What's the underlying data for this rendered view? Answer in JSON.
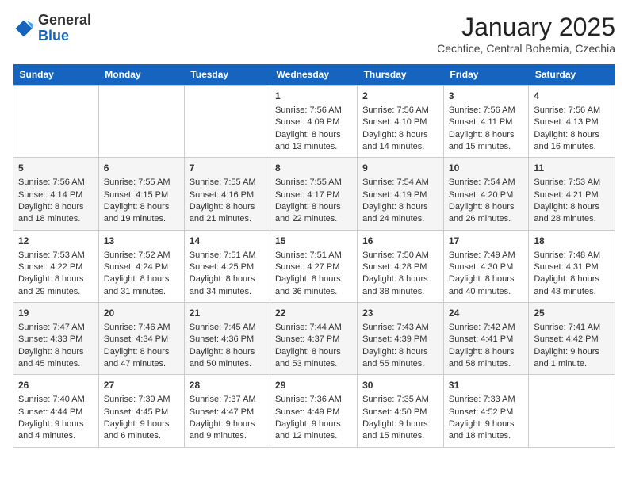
{
  "header": {
    "logo_line1": "General",
    "logo_line2": "Blue",
    "title": "January 2025",
    "location": "Cechtice, Central Bohemia, Czechia"
  },
  "days_of_week": [
    "Sunday",
    "Monday",
    "Tuesday",
    "Wednesday",
    "Thursday",
    "Friday",
    "Saturday"
  ],
  "weeks": [
    [
      {
        "day": "",
        "info": ""
      },
      {
        "day": "",
        "info": ""
      },
      {
        "day": "",
        "info": ""
      },
      {
        "day": "1",
        "info": "Sunrise: 7:56 AM\nSunset: 4:09 PM\nDaylight: 8 hours\nand 13 minutes."
      },
      {
        "day": "2",
        "info": "Sunrise: 7:56 AM\nSunset: 4:10 PM\nDaylight: 8 hours\nand 14 minutes."
      },
      {
        "day": "3",
        "info": "Sunrise: 7:56 AM\nSunset: 4:11 PM\nDaylight: 8 hours\nand 15 minutes."
      },
      {
        "day": "4",
        "info": "Sunrise: 7:56 AM\nSunset: 4:13 PM\nDaylight: 8 hours\nand 16 minutes."
      }
    ],
    [
      {
        "day": "5",
        "info": "Sunrise: 7:56 AM\nSunset: 4:14 PM\nDaylight: 8 hours\nand 18 minutes."
      },
      {
        "day": "6",
        "info": "Sunrise: 7:55 AM\nSunset: 4:15 PM\nDaylight: 8 hours\nand 19 minutes."
      },
      {
        "day": "7",
        "info": "Sunrise: 7:55 AM\nSunset: 4:16 PM\nDaylight: 8 hours\nand 21 minutes."
      },
      {
        "day": "8",
        "info": "Sunrise: 7:55 AM\nSunset: 4:17 PM\nDaylight: 8 hours\nand 22 minutes."
      },
      {
        "day": "9",
        "info": "Sunrise: 7:54 AM\nSunset: 4:19 PM\nDaylight: 8 hours\nand 24 minutes."
      },
      {
        "day": "10",
        "info": "Sunrise: 7:54 AM\nSunset: 4:20 PM\nDaylight: 8 hours\nand 26 minutes."
      },
      {
        "day": "11",
        "info": "Sunrise: 7:53 AM\nSunset: 4:21 PM\nDaylight: 8 hours\nand 28 minutes."
      }
    ],
    [
      {
        "day": "12",
        "info": "Sunrise: 7:53 AM\nSunset: 4:22 PM\nDaylight: 8 hours\nand 29 minutes."
      },
      {
        "day": "13",
        "info": "Sunrise: 7:52 AM\nSunset: 4:24 PM\nDaylight: 8 hours\nand 31 minutes."
      },
      {
        "day": "14",
        "info": "Sunrise: 7:51 AM\nSunset: 4:25 PM\nDaylight: 8 hours\nand 34 minutes."
      },
      {
        "day": "15",
        "info": "Sunrise: 7:51 AM\nSunset: 4:27 PM\nDaylight: 8 hours\nand 36 minutes."
      },
      {
        "day": "16",
        "info": "Sunrise: 7:50 AM\nSunset: 4:28 PM\nDaylight: 8 hours\nand 38 minutes."
      },
      {
        "day": "17",
        "info": "Sunrise: 7:49 AM\nSunset: 4:30 PM\nDaylight: 8 hours\nand 40 minutes."
      },
      {
        "day": "18",
        "info": "Sunrise: 7:48 AM\nSunset: 4:31 PM\nDaylight: 8 hours\nand 43 minutes."
      }
    ],
    [
      {
        "day": "19",
        "info": "Sunrise: 7:47 AM\nSunset: 4:33 PM\nDaylight: 8 hours\nand 45 minutes."
      },
      {
        "day": "20",
        "info": "Sunrise: 7:46 AM\nSunset: 4:34 PM\nDaylight: 8 hours\nand 47 minutes."
      },
      {
        "day": "21",
        "info": "Sunrise: 7:45 AM\nSunset: 4:36 PM\nDaylight: 8 hours\nand 50 minutes."
      },
      {
        "day": "22",
        "info": "Sunrise: 7:44 AM\nSunset: 4:37 PM\nDaylight: 8 hours\nand 53 minutes."
      },
      {
        "day": "23",
        "info": "Sunrise: 7:43 AM\nSunset: 4:39 PM\nDaylight: 8 hours\nand 55 minutes."
      },
      {
        "day": "24",
        "info": "Sunrise: 7:42 AM\nSunset: 4:41 PM\nDaylight: 8 hours\nand 58 minutes."
      },
      {
        "day": "25",
        "info": "Sunrise: 7:41 AM\nSunset: 4:42 PM\nDaylight: 9 hours\nand 1 minute."
      }
    ],
    [
      {
        "day": "26",
        "info": "Sunrise: 7:40 AM\nSunset: 4:44 PM\nDaylight: 9 hours\nand 4 minutes."
      },
      {
        "day": "27",
        "info": "Sunrise: 7:39 AM\nSunset: 4:45 PM\nDaylight: 9 hours\nand 6 minutes."
      },
      {
        "day": "28",
        "info": "Sunrise: 7:37 AM\nSunset: 4:47 PM\nDaylight: 9 hours\nand 9 minutes."
      },
      {
        "day": "29",
        "info": "Sunrise: 7:36 AM\nSunset: 4:49 PM\nDaylight: 9 hours\nand 12 minutes."
      },
      {
        "day": "30",
        "info": "Sunrise: 7:35 AM\nSunset: 4:50 PM\nDaylight: 9 hours\nand 15 minutes."
      },
      {
        "day": "31",
        "info": "Sunrise: 7:33 AM\nSunset: 4:52 PM\nDaylight: 9 hours\nand 18 minutes."
      },
      {
        "day": "",
        "info": ""
      }
    ]
  ]
}
